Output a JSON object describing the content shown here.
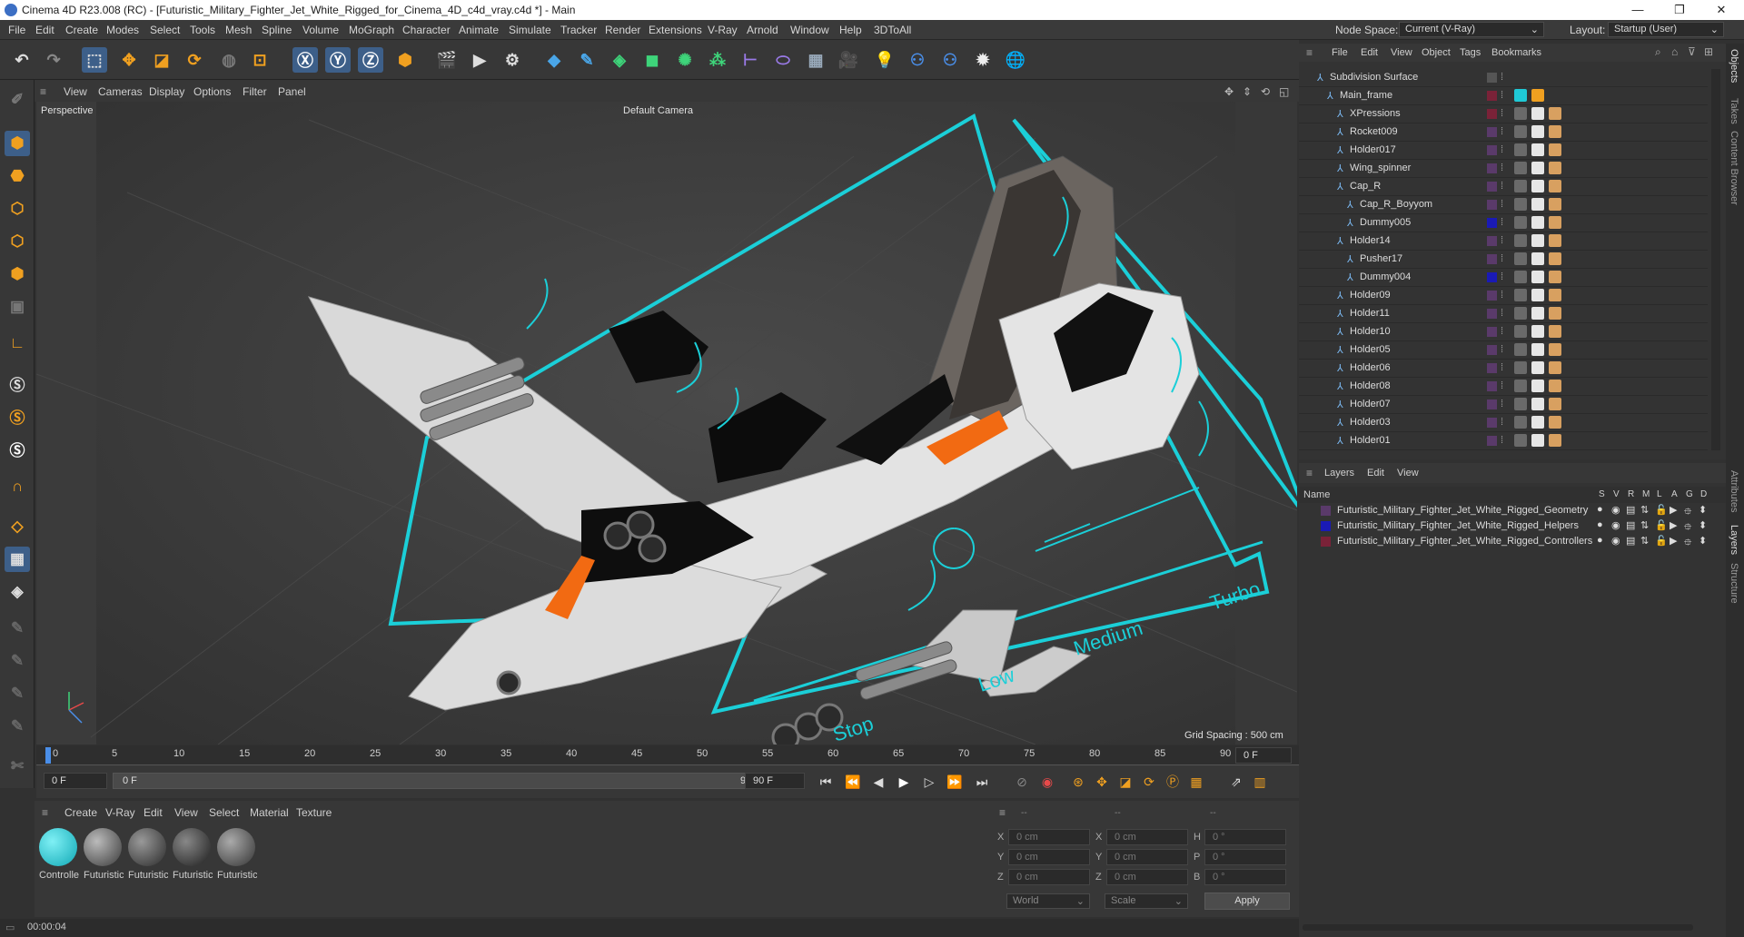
{
  "window": {
    "title": "Cinema 4D R23.008 (RC) - [Futuristic_Military_Fighter_Jet_White_Rigged_for_Cinema_4D_c4d_vray.c4d *] - Main"
  },
  "menu": [
    "File",
    "Edit",
    "Create",
    "Modes",
    "Select",
    "Tools",
    "Mesh",
    "Spline",
    "Volume",
    "MoGraph",
    "Character",
    "Animate",
    "Simulate",
    "Tracker",
    "Render",
    "Extensions",
    "V-Ray",
    "Arnold",
    "Window",
    "Help",
    "3DToAll"
  ],
  "node_space": {
    "label": "Node Space:",
    "value": "Current (V-Ray)"
  },
  "layout": {
    "label": "Layout:",
    "value": "Startup (User)"
  },
  "viewport": {
    "menu": [
      "View",
      "Cameras",
      "Display",
      "Options",
      "Filter",
      "Panel"
    ],
    "view_name": "Perspective",
    "camera": "Default Camera",
    "grid_spacing": "Grid Spacing : 500 cm",
    "hud_labels": {
      "low": "Low",
      "medium": "Medium",
      "turbo": "Turbo",
      "stop": "Stop"
    }
  },
  "timeline": {
    "ticks": [
      "0",
      "5",
      "10",
      "15",
      "20",
      "25",
      "30",
      "35",
      "40",
      "45",
      "50",
      "55",
      "60",
      "65",
      "70",
      "75",
      "80",
      "85",
      "90"
    ],
    "current_frame": "0 F",
    "start": "0 F",
    "range_start": "0 F",
    "range_end": "90 F",
    "end": "90 F"
  },
  "materials": {
    "menu": [
      "Create",
      "V-Ray",
      "Edit",
      "View",
      "Select",
      "Material",
      "Texture"
    ],
    "items": [
      {
        "label": "Controlle",
        "color": "#1fc9d6"
      },
      {
        "label": "Futuristic",
        "color": "#7a7a7a"
      },
      {
        "label": "Futuristic",
        "color": "#5e5e5e"
      },
      {
        "label": "Futuristic",
        "color": "#4a4a4a"
      },
      {
        "label": "Futuristic",
        "color": "#666666"
      }
    ]
  },
  "coords": {
    "headers": [
      "--",
      "--",
      "--"
    ],
    "rows": [
      {
        "a": "X",
        "av": "0 cm",
        "b": "X",
        "bv": "0 cm",
        "c": "H",
        "cv": "0 °"
      },
      {
        "a": "Y",
        "av": "0 cm",
        "b": "Y",
        "bv": "0 cm",
        "c": "P",
        "cv": "0 °"
      },
      {
        "a": "Z",
        "av": "0 cm",
        "b": "Z",
        "bv": "0 cm",
        "c": "B",
        "cv": "0 °"
      }
    ],
    "mode": "World",
    "scale": "Scale",
    "apply": "Apply"
  },
  "status": {
    "time": "00:00:04"
  },
  "objects": {
    "menu": [
      "File",
      "Edit",
      "View",
      "Object",
      "Tags",
      "Bookmarks"
    ],
    "items": [
      {
        "name": "Subdivision Surface",
        "indent": 0,
        "color": "#555555"
      },
      {
        "name": "Main_frame",
        "indent": 1,
        "color": "#7a2238"
      },
      {
        "name": "XPressions",
        "indent": 2,
        "color": "#7a2238"
      },
      {
        "name": "Rocket009",
        "indent": 2,
        "color": "#5a3a6a"
      },
      {
        "name": "Holder017",
        "indent": 2,
        "color": "#5a3a6a"
      },
      {
        "name": "Wing_spinner",
        "indent": 2,
        "color": "#5a3a6a"
      },
      {
        "name": "Cap_R",
        "indent": 2,
        "color": "#5a3a6a"
      },
      {
        "name": "Cap_R_Boyyom",
        "indent": 3,
        "color": "#5a3a6a"
      },
      {
        "name": "Dummy005",
        "indent": 3,
        "color": "#1a1ab5"
      },
      {
        "name": "Holder14",
        "indent": 2,
        "color": "#5a3a6a"
      },
      {
        "name": "Pusher17",
        "indent": 3,
        "color": "#5a3a6a"
      },
      {
        "name": "Dummy004",
        "indent": 3,
        "color": "#1a1ab5"
      },
      {
        "name": "Holder09",
        "indent": 2,
        "color": "#5a3a6a"
      },
      {
        "name": "Holder11",
        "indent": 2,
        "color": "#5a3a6a"
      },
      {
        "name": "Holder10",
        "indent": 2,
        "color": "#5a3a6a"
      },
      {
        "name": "Holder05",
        "indent": 2,
        "color": "#5a3a6a"
      },
      {
        "name": "Holder06",
        "indent": 2,
        "color": "#5a3a6a"
      },
      {
        "name": "Holder08",
        "indent": 2,
        "color": "#5a3a6a"
      },
      {
        "name": "Holder07",
        "indent": 2,
        "color": "#5a3a6a"
      },
      {
        "name": "Holder03",
        "indent": 2,
        "color": "#5a3a6a"
      },
      {
        "name": "Holder01",
        "indent": 2,
        "color": "#5a3a6a"
      }
    ]
  },
  "layers": {
    "menu": [
      "Layers",
      "Edit",
      "View"
    ],
    "header": {
      "name": "Name",
      "cols": [
        "S",
        "V",
        "R",
        "M",
        "L",
        "A",
        "G",
        "D"
      ]
    },
    "items": [
      {
        "name": "Futuristic_Military_Fighter_Jet_White_Rigged_Geometry",
        "color": "#5a3a6a"
      },
      {
        "name": "Futuristic_Military_Fighter_Jet_White_Rigged_Helpers",
        "color": "#1a1ab5"
      },
      {
        "name": "Futuristic_Military_Fighter_Jet_White_Rigged_Controllers",
        "color": "#7a2238"
      }
    ]
  },
  "side_tabs": [
    "Objects",
    "Takes",
    "Content Browser",
    "Attributes",
    "Layers",
    "Structure"
  ]
}
